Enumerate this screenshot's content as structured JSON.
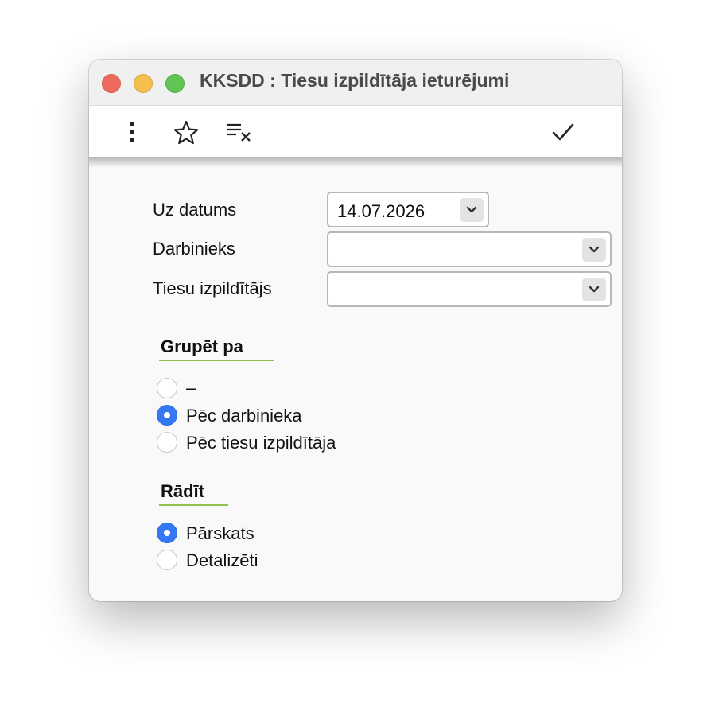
{
  "window": {
    "title": "KKSDD : Tiesu izpildītāja ieturējumi"
  },
  "toolbar": {
    "items": [
      {
        "name": "more-icon"
      },
      {
        "name": "star-icon"
      },
      {
        "name": "clear-filter-icon"
      },
      {
        "name": "checkmark-icon"
      }
    ]
  },
  "form": {
    "date_label": "Uz datums",
    "date_value": "14.07.2026",
    "employee_label": "Darbinieks",
    "employee_value": "",
    "bailiff_label": "Tiesu izpildītājs",
    "bailiff_value": ""
  },
  "group_by": {
    "title": "Grupēt pa",
    "options": [
      {
        "label": "–",
        "checked": false
      },
      {
        "label": "Pēc darbinieka",
        "checked": true
      },
      {
        "label": "Pēc tiesu izpildītāja",
        "checked": false
      }
    ]
  },
  "show": {
    "title": "Rādīt",
    "options": [
      {
        "label": "Pārskats",
        "checked": true
      },
      {
        "label": "Detalizēti",
        "checked": false
      }
    ]
  },
  "colors": {
    "accent_radio": "#3478f6",
    "section_underline": "#8fc251",
    "traffic_close": "#ed6a5e",
    "traffic_min": "#f5bf4f",
    "traffic_max": "#61c454"
  }
}
